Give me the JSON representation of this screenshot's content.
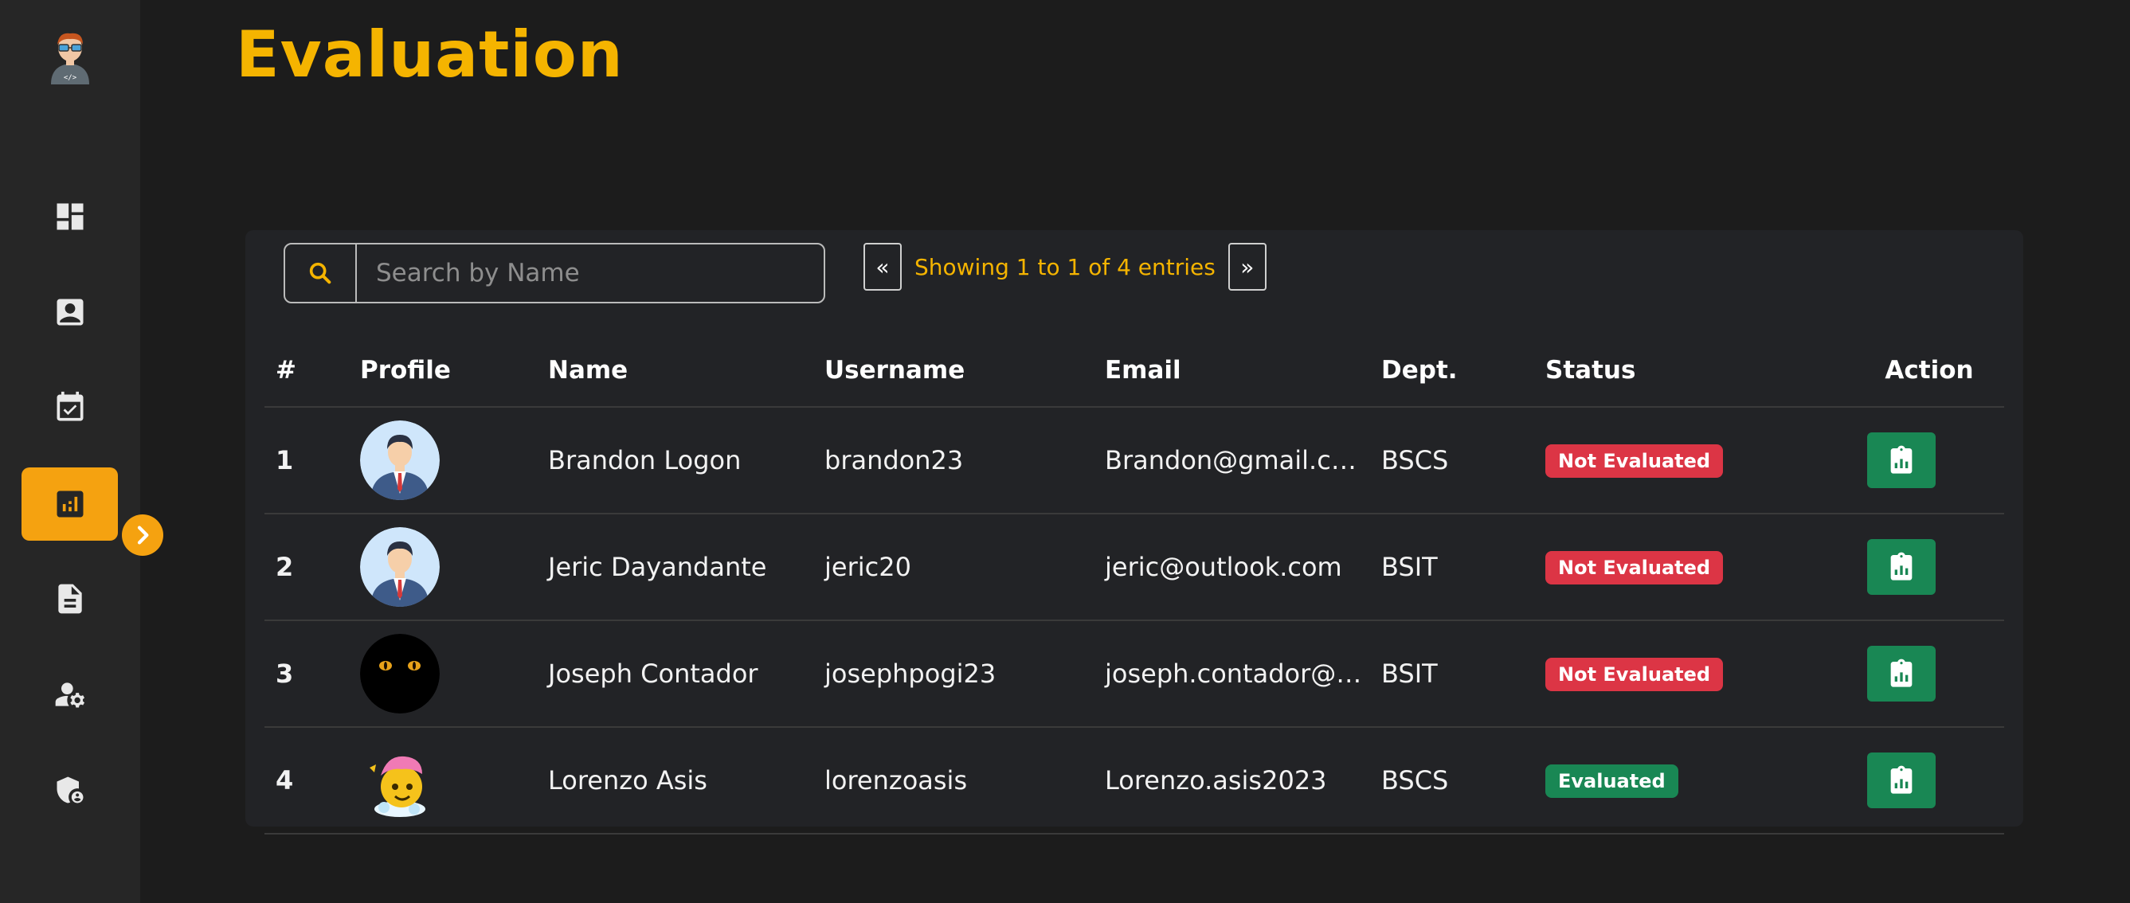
{
  "page": {
    "title": "Evaluation"
  },
  "sidebar": {
    "items": [
      {
        "icon": "dashboard-icon",
        "active": false
      },
      {
        "icon": "profile-card-icon",
        "active": false
      },
      {
        "icon": "calendar-check-icon",
        "active": false
      },
      {
        "icon": "analytics-icon",
        "active": true
      },
      {
        "icon": "document-icon",
        "active": false
      },
      {
        "icon": "user-settings-icon",
        "active": false
      },
      {
        "icon": "shield-user-icon",
        "active": false
      }
    ],
    "accent": "#f5a210"
  },
  "search": {
    "placeholder": "Search by Name",
    "value": ""
  },
  "pagination": {
    "prev": "«",
    "next": "»",
    "info": "Showing 1 to 1 of 4 entries"
  },
  "table": {
    "headers": [
      "#",
      "Profile",
      "Name",
      "Username",
      "Email",
      "Dept.",
      "Status",
      "Action"
    ],
    "rows": [
      {
        "num": "1",
        "avatar": "businessman",
        "name": "Brandon Logon",
        "username": "brandon23",
        "email": "Brandon@gmail.com",
        "dept": "BSCS",
        "status": "Not Evaluated"
      },
      {
        "num": "2",
        "avatar": "businessman",
        "name": "Jeric Dayandante",
        "username": "jeric20",
        "email": "jeric@outlook.com",
        "dept": "BSIT",
        "status": "Not Evaluated"
      },
      {
        "num": "3",
        "avatar": "cat-eyes",
        "name": "Joseph Contador",
        "username": "josephpogi23",
        "email": "joseph.contador@gmail.com",
        "dept": "BSIT",
        "status": "Not Evaluated"
      },
      {
        "num": "4",
        "avatar": "emoji-bath",
        "name": "Lorenzo Asis",
        "username": "lorenzoasis",
        "email": "Lorenzo.asis2023",
        "dept": "BSCS",
        "status": "Evaluated"
      }
    ]
  },
  "colors": {
    "title": "#f5b400",
    "not_evaluated": "#dc3545",
    "evaluated": "#198754"
  }
}
